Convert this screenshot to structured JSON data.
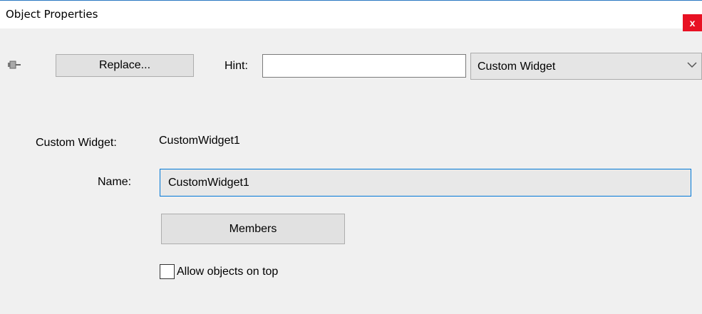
{
  "window": {
    "title": "Object Properties",
    "close_label": "x"
  },
  "toolbar": {
    "pin_icon": "pin-icon",
    "replace_label": "Replace...",
    "hint_label": "Hint:",
    "hint_value": "",
    "type_selected": "Custom Widget",
    "dropdown_icon": "chevron-down-icon"
  },
  "form": {
    "custom_widget_label": "Custom Widget:",
    "custom_widget_value": "CustomWidget1",
    "name_label": "Name:",
    "name_value": "CustomWidget1",
    "members_label": "Members",
    "allow_on_top_label": "Allow objects on top",
    "allow_on_top_checked": false
  },
  "colors": {
    "close_button": "#e81123",
    "focus_border": "#0078d7"
  }
}
